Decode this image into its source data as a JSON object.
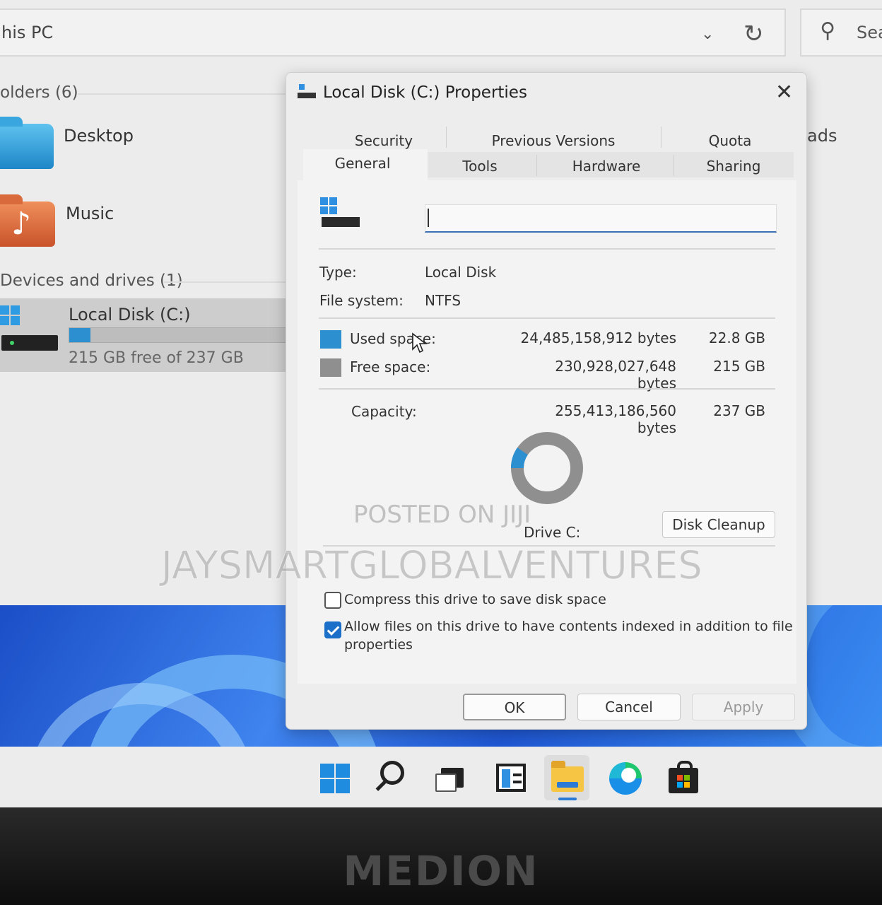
{
  "explorer": {
    "address": "his PC",
    "search_placeholder": "Sea",
    "folders_header": "olders (6)",
    "folders": [
      {
        "name": "Desktop"
      },
      {
        "name": "Music"
      }
    ],
    "devices_header": "Devices and drives (1)",
    "drive": {
      "name": "Local Disk (C:)",
      "free_text": "215 GB free of 237 GB",
      "used_fraction": 0.096
    },
    "right_fragment": "ads"
  },
  "dialog": {
    "title": "Local Disk (C:) Properties",
    "tabs_row1": [
      "Security",
      "Previous Versions",
      "Quota"
    ],
    "tabs_row2": [
      "General",
      "Tools",
      "Hardware",
      "Sharing"
    ],
    "active_tab": "General",
    "name_value": "",
    "type_label": "Type:",
    "type_value": "Local Disk",
    "fs_label": "File system:",
    "fs_value": "NTFS",
    "used": {
      "label": "Used space:",
      "bytes": "24,485,158,912 bytes",
      "size": "22.8 GB",
      "color": "#2b8fd0"
    },
    "free": {
      "label": "Free space:",
      "bytes": "230,928,027,648 bytes",
      "size": "215 GB",
      "color": "#8f8f8f"
    },
    "capacity": {
      "label": "Capacity:",
      "bytes": "255,413,186,560 bytes",
      "size": "237 GB"
    },
    "usage_fraction": 0.096,
    "drive_label": "Drive C:",
    "disk_cleanup": "Disk Cleanup",
    "compress_label": "Compress this drive to save disk space",
    "compress_checked": false,
    "index_label_line1": "Allow files on this drive to have contents indexed in addition to file",
    "index_label_line2": "properties",
    "index_checked": true,
    "buttons": {
      "ok": "OK",
      "cancel": "Cancel",
      "apply": "Apply"
    }
  },
  "watermark": {
    "line1": "POSTED ON JIJI",
    "line2": "JAYSMARTGLOBALVENTURES"
  },
  "brand": "MEDION",
  "icons": [
    "start-icon",
    "search-icon",
    "task-view-icon",
    "widgets-icon",
    "file-explorer-icon",
    "edge-icon",
    "store-icon"
  ]
}
